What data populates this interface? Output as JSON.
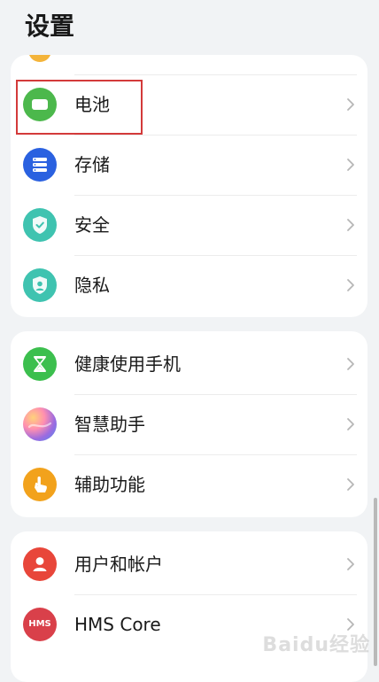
{
  "header": {
    "title": "设置"
  },
  "groups": [
    {
      "items": [
        {
          "label": "电池",
          "icon": "battery-icon",
          "color": "#4cb84c"
        },
        {
          "label": "存储",
          "icon": "storage-icon",
          "color": "#2a61e0"
        },
        {
          "label": "安全",
          "icon": "shield-icon",
          "color": "#3fc3b0"
        },
        {
          "label": "隐私",
          "icon": "privacy-icon",
          "color": "#3fc3b0"
        }
      ]
    },
    {
      "items": [
        {
          "label": "健康使用手机",
          "icon": "hourglass-icon",
          "color": "#3cbf4e"
        },
        {
          "label": "智慧助手",
          "icon": "assistant-icon",
          "color": "#9b6be0"
        },
        {
          "label": "辅助功能",
          "icon": "accessibility-hand-icon",
          "color": "#f2a21c"
        }
      ]
    },
    {
      "items": [
        {
          "label": "用户和帐户",
          "icon": "user-icon",
          "color": "#e8463a"
        },
        {
          "label": "HMS Core",
          "icon": "hms-icon",
          "color": "#d9404a",
          "badge": "HMS"
        }
      ]
    }
  ],
  "watermark": "Baidu经验"
}
